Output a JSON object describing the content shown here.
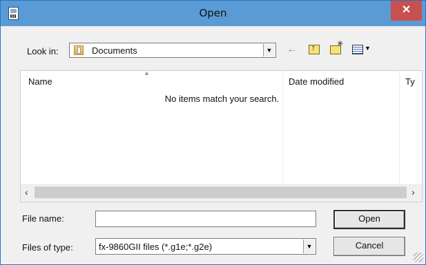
{
  "window": {
    "title": "Open",
    "close_label": "✕"
  },
  "toolbar": {
    "look_in_label": "Look in:",
    "look_in_value": "Documents",
    "icons": [
      "back-arrow-icon",
      "up-folder-icon",
      "new-folder-icon",
      "view-menu-icon"
    ]
  },
  "list": {
    "columns": [
      "Name",
      "Date modified",
      "Ty"
    ],
    "empty_message": "No items match your search."
  },
  "form": {
    "file_name_label": "File name:",
    "file_name_value": "",
    "files_of_type_label": "Files of type:",
    "files_of_type_value": "fx-9860GII files (*.g1e;*.g2e)"
  },
  "buttons": {
    "open": "Open",
    "cancel": "Cancel"
  }
}
